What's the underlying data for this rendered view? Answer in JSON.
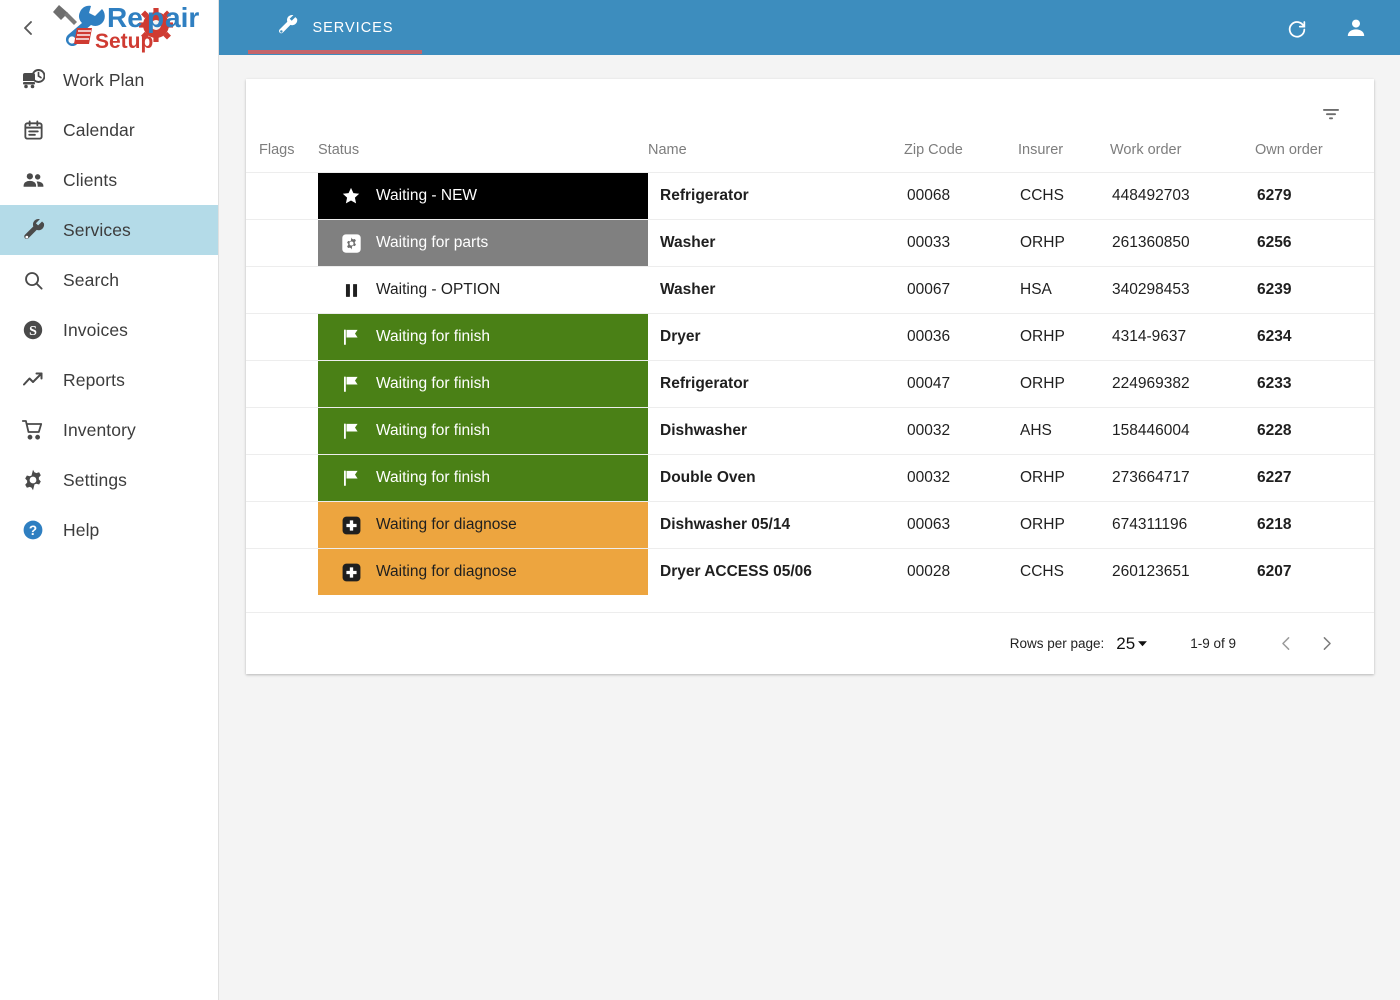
{
  "brand": {
    "name_primary": "Repair",
    "name_secondary": "Setup"
  },
  "sidebar": {
    "collapse_icon": "chevron-left-icon",
    "items": [
      {
        "label": "Work Plan",
        "icon": "work-plan-icon",
        "active": false
      },
      {
        "label": "Calendar",
        "icon": "calendar-icon",
        "active": false
      },
      {
        "label": "Clients",
        "icon": "people-icon",
        "active": false
      },
      {
        "label": "Services",
        "icon": "wrench-icon",
        "active": true
      },
      {
        "label": "Search",
        "icon": "search-icon",
        "active": false
      },
      {
        "label": "Invoices",
        "icon": "dollar-icon",
        "active": false
      },
      {
        "label": "Reports",
        "icon": "trending-up-icon",
        "active": false
      },
      {
        "label": "Inventory",
        "icon": "cart-icon",
        "active": false
      },
      {
        "label": "Settings",
        "icon": "gear-icon",
        "active": false
      },
      {
        "label": "Help",
        "icon": "help-circle-icon",
        "active": false
      }
    ]
  },
  "topbar": {
    "tab_label": "SERVICES",
    "tab_icon": "wrench-icon",
    "refresh_icon": "refresh-icon",
    "account_icon": "person-icon",
    "background": "#3d8dbe",
    "underline_color": "#c4656a"
  },
  "table": {
    "filter_icon": "filter-icon",
    "columns": [
      "Flags",
      "Status",
      "Name",
      "Zip Code",
      "Insurer",
      "Work order",
      "Own order"
    ],
    "rows": [
      {
        "flags": "",
        "status": "Waiting - NEW",
        "status_icon": "star-icon",
        "status_bg": "#000000",
        "status_fg": "#ffffff",
        "name": "Refrigerator",
        "zip": "00068",
        "insurer": "CCHS",
        "work_order": "448492703",
        "own_order": "6279"
      },
      {
        "flags": "",
        "status": "Waiting for parts",
        "status_icon": "gear-box-icon",
        "status_bg": "#808080",
        "status_fg": "#ffffff",
        "name": "Washer",
        "zip": "00033",
        "insurer": "ORHP",
        "work_order": "261360850",
        "own_order": "6256"
      },
      {
        "flags": "",
        "status": "Waiting - OPTION",
        "status_icon": "pause-icon",
        "status_bg": "#ffffff",
        "status_fg": "#1f1f1f",
        "name": "Washer",
        "zip": "00067",
        "insurer": "HSA",
        "work_order": "340298453",
        "own_order": "6239"
      },
      {
        "flags": "",
        "status": "Waiting for finish",
        "status_icon": "flag-icon",
        "status_bg": "#4a8016",
        "status_fg": "#ffffff",
        "name": "Dryer",
        "zip": "00036",
        "insurer": "ORHP",
        "work_order": "4314-9637",
        "own_order": "6234"
      },
      {
        "flags": "",
        "status": "Waiting for finish",
        "status_icon": "flag-icon",
        "status_bg": "#4a8016",
        "status_fg": "#ffffff",
        "name": "Refrigerator",
        "zip": "00047",
        "insurer": "ORHP",
        "work_order": "224969382",
        "own_order": "6233"
      },
      {
        "flags": "",
        "status": "Waiting for finish",
        "status_icon": "flag-icon",
        "status_bg": "#4a8016",
        "status_fg": "#ffffff",
        "name": "Dishwasher",
        "zip": "00032",
        "insurer": "AHS",
        "work_order": "158446004",
        "own_order": "6228"
      },
      {
        "flags": "",
        "status": "Waiting for finish",
        "status_icon": "flag-icon",
        "status_bg": "#4a8016",
        "status_fg": "#ffffff",
        "name": "Double Oven",
        "zip": "00032",
        "insurer": "ORHP",
        "work_order": "273664717",
        "own_order": "6227"
      },
      {
        "flags": "",
        "status": "Waiting for diagnose",
        "status_icon": "plus-box-icon",
        "status_bg": "#eda householder",
        "status_fg": "#1f1f1f",
        "name": "Dishwasher 05/14",
        "zip": "00063",
        "insurer": "ORHP",
        "work_order": "674311196",
        "own_order": "6218"
      },
      {
        "flags": "",
        "status": "Waiting for diagnose",
        "status_icon": "plus-box-icon",
        "status_bg": "#eda53f",
        "status_fg": "#1f1f1f",
        "name": "Dryer ACCESS 05/06",
        "zip": "00028",
        "insurer": "CCHS",
        "work_order": "260123651",
        "own_order": "6207"
      }
    ]
  },
  "pagination": {
    "rows_per_page_label": "Rows per page:",
    "rows_per_page_value": "25",
    "range_label": "1-9 of 9",
    "prev_icon": "chevron-left-icon",
    "next_icon": "chevron-right-icon"
  }
}
